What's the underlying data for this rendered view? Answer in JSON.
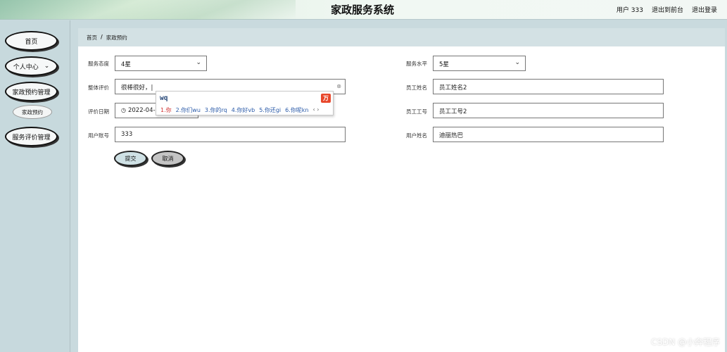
{
  "header": {
    "title": "家政服务系统",
    "user_label": "用户 333",
    "to_frontend": "退出到前台",
    "logout": "退出登录"
  },
  "sidebar": {
    "items": [
      {
        "label": "首页"
      },
      {
        "label": "个人中心",
        "chevron": "⌄"
      },
      {
        "label": "家政预约管理"
      },
      {
        "label": "家政预约",
        "sub": true
      },
      {
        "label": "服务评价管理"
      }
    ]
  },
  "breadcrumb": {
    "home": "首页",
    "separator": "/",
    "current": "家政预约"
  },
  "form": {
    "service_attitude": {
      "label": "服务态度",
      "value": "4星"
    },
    "service_level": {
      "label": "服务水平",
      "value": "5星"
    },
    "overall_review": {
      "label": "整体评价",
      "value": "很棒很好，|"
    },
    "staff_name": {
      "label": "员工姓名",
      "value": "员工姓名2"
    },
    "review_date": {
      "label": "评价日期",
      "value": "2022-04-03"
    },
    "staff_id": {
      "label": "员工工号",
      "value": "员工工号2"
    },
    "user_account": {
      "label": "用户账号",
      "value": "333"
    },
    "user_name": {
      "label": "用户姓名",
      "value": "迪丽热巴"
    },
    "submit_label": "提交",
    "cancel_label": "取消"
  },
  "ime": {
    "composing": "wq",
    "logo": "万",
    "candidates": [
      "1.你",
      "2.你们wu",
      "3.你的rq",
      "4.你好vb",
      "5.你还gi",
      "6.你呢kn"
    ],
    "pager": "‹ ›"
  },
  "watermark": "CSDN @小奔程序"
}
